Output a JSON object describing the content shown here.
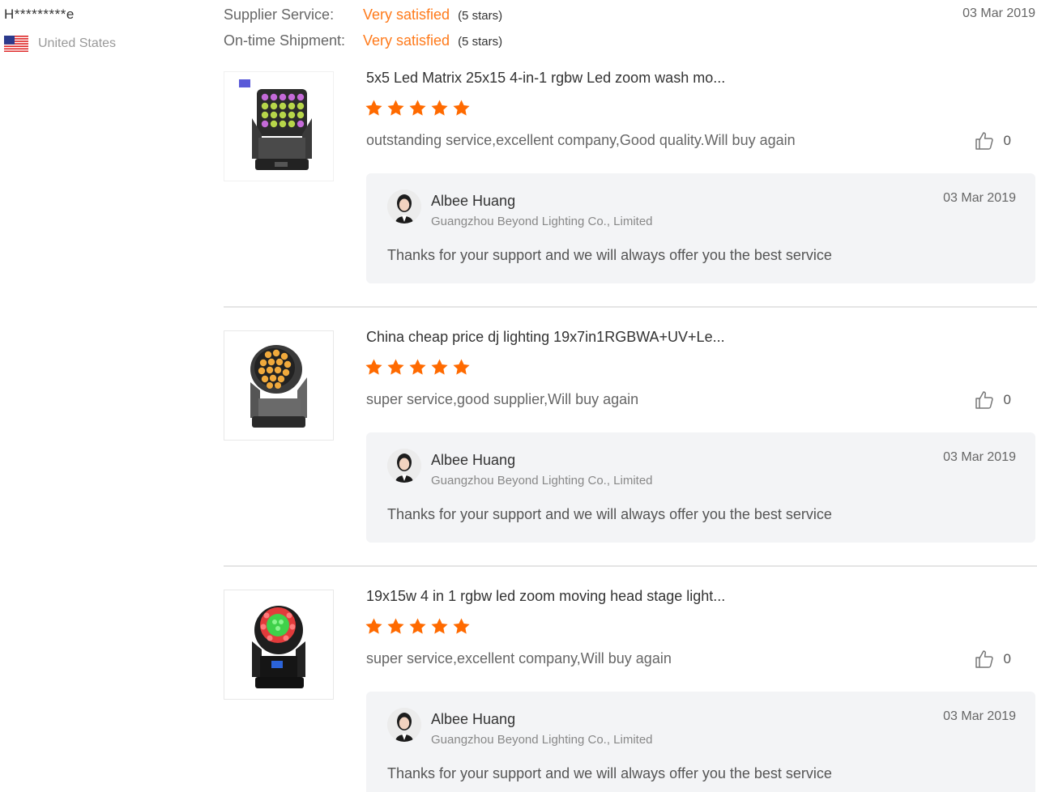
{
  "buyer": {
    "name": "H*********e",
    "country": "United States"
  },
  "ratings": [
    {
      "label": "Supplier Service:",
      "value": "Very satisfied",
      "stars": "(5 stars)"
    },
    {
      "label": "On-time Shipment:",
      "value": "Very satisfied",
      "stars": "(5 stars)"
    }
  ],
  "review_date": "03 Mar 2019",
  "colors": {
    "accent": "#ff7a1a",
    "star": "#ff6a00"
  },
  "reviews": [
    {
      "product_title": "5x5 Led Matrix 25x15 4-in-1 rgbw Led zoom wash mo...",
      "rating": 5,
      "comment": "outstanding service,excellent company,Good quality.Will buy again",
      "likes": "0",
      "reply": {
        "name": "Albee Huang",
        "company": "Guangzhou Beyond Lighting Co., Limited",
        "date": "03 Mar 2019",
        "text": "Thanks for your support and we will always offer you the best service"
      }
    },
    {
      "product_title": "China cheap price dj lighting 19x7in1RGBWA+UV+Le...",
      "rating": 5,
      "comment": "super service,good supplier,Will buy again",
      "likes": "0",
      "reply": {
        "name": "Albee Huang",
        "company": "Guangzhou Beyond Lighting Co., Limited",
        "date": "03 Mar 2019",
        "text": "Thanks for your support and we will always offer you the best service"
      }
    },
    {
      "product_title": "19x15w 4 in 1 rgbw led zoom moving head stage light...",
      "rating": 5,
      "comment": "super service,excellent company,Will buy again",
      "likes": "0",
      "reply": {
        "name": "Albee Huang",
        "company": "Guangzhou Beyond Lighting Co., Limited",
        "date": "03 Mar 2019",
        "text": "Thanks for your support and we will always offer you the best service"
      }
    }
  ]
}
